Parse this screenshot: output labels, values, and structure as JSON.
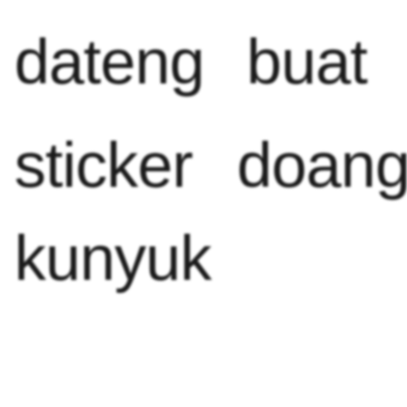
{
  "lines": [
    {
      "words": [
        "dateng",
        "buat"
      ]
    },
    {
      "words": [
        "sticker",
        "doang"
      ]
    },
    {
      "words": [
        "kunyuk"
      ]
    }
  ],
  "colors": {
    "background": "#ffffff",
    "text": "#1a1a1a"
  }
}
